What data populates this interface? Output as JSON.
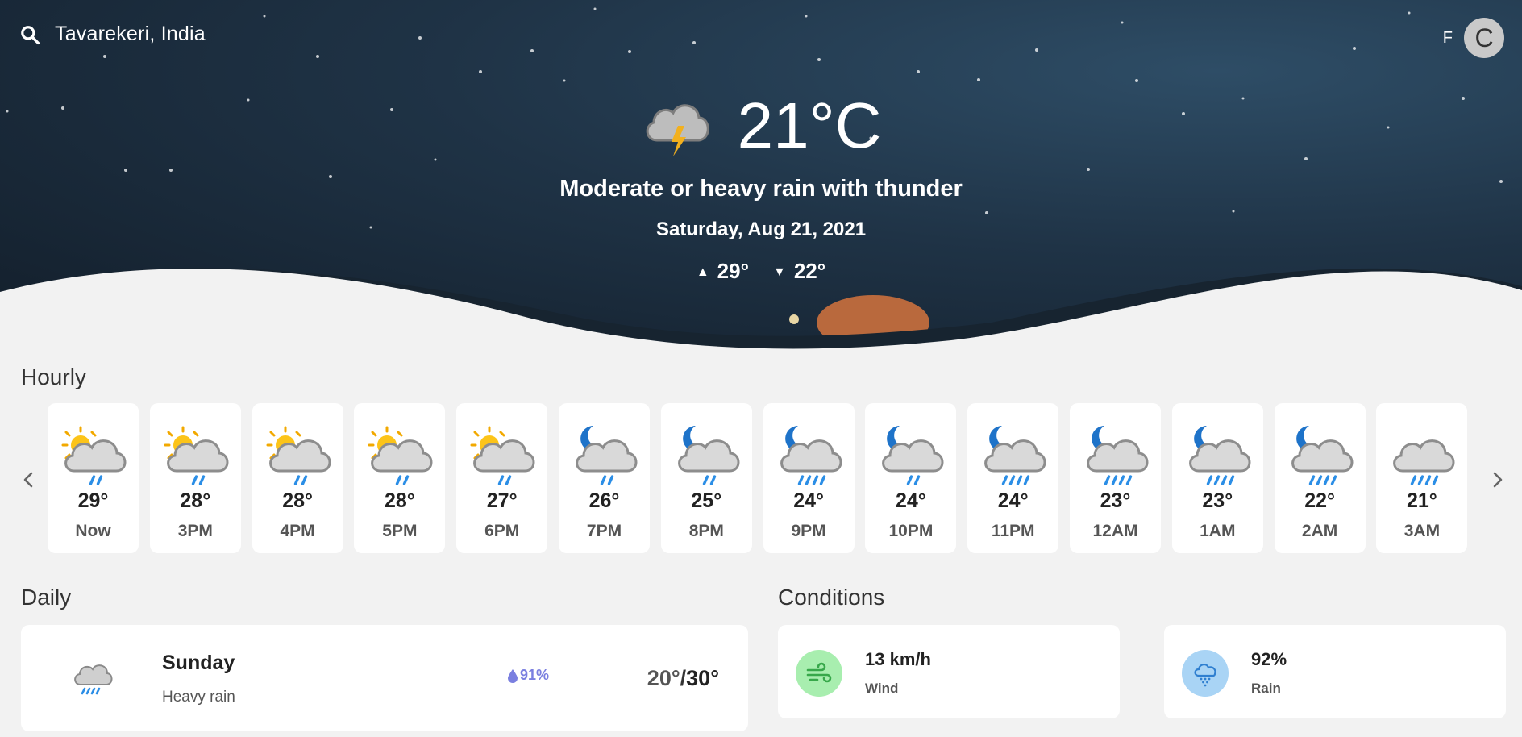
{
  "search": {
    "location": "Tavarekeri, India"
  },
  "units": {
    "fahrenheit": "F",
    "celsius": "C"
  },
  "current": {
    "temp": "21°C",
    "condition": "Moderate or heavy rain with thunder",
    "date": "Saturday, Aug 21, 2021",
    "high": "29°",
    "low": "22°",
    "icon": "thunder-cloud-icon"
  },
  "hourly": {
    "title": "Hourly",
    "items": [
      {
        "temp": "29°",
        "label": "Now",
        "icon": "sun-cloud-light-rain",
        "rain_lines": 2
      },
      {
        "temp": "28°",
        "label": "3PM",
        "icon": "sun-cloud-light-rain",
        "rain_lines": 2
      },
      {
        "temp": "28°",
        "label": "4PM",
        "icon": "sun-cloud-light-rain",
        "rain_lines": 2
      },
      {
        "temp": "28°",
        "label": "5PM",
        "icon": "sun-cloud-light-rain",
        "rain_lines": 2
      },
      {
        "temp": "27°",
        "label": "6PM",
        "icon": "sun-cloud-light-rain",
        "rain_lines": 2
      },
      {
        "temp": "26°",
        "label": "7PM",
        "icon": "moon-cloud-light-rain",
        "rain_lines": 2
      },
      {
        "temp": "25°",
        "label": "8PM",
        "icon": "moon-cloud-light-rain",
        "rain_lines": 2
      },
      {
        "temp": "24°",
        "label": "9PM",
        "icon": "moon-cloud-heavy-rain",
        "rain_lines": 4
      },
      {
        "temp": "24°",
        "label": "10PM",
        "icon": "moon-cloud-light-rain",
        "rain_lines": 2
      },
      {
        "temp": "24°",
        "label": "11PM",
        "icon": "moon-cloud-heavy-rain",
        "rain_lines": 4
      },
      {
        "temp": "23°",
        "label": "12AM",
        "icon": "moon-cloud-heavy-rain",
        "rain_lines": 4
      },
      {
        "temp": "23°",
        "label": "1AM",
        "icon": "moon-cloud-heavy-rain",
        "rain_lines": 4
      },
      {
        "temp": "22°",
        "label": "2AM",
        "icon": "moon-cloud-heavy-rain",
        "rain_lines": 4
      },
      {
        "temp": "21°",
        "label": "3AM",
        "icon": "cloud-heavy-rain",
        "rain_lines": 4
      }
    ]
  },
  "daily": {
    "title": "Daily",
    "items": [
      {
        "day": "Sunday",
        "description": "Heavy rain",
        "precip": "91%",
        "low": "20°",
        "high": "30°",
        "icon": "cloud-heavy-rain"
      }
    ]
  },
  "conditions": {
    "title": "Conditions",
    "wind": {
      "value": "13 km/h",
      "label": "Wind",
      "icon": "wind-icon",
      "color": "#a8eeaf"
    },
    "rain": {
      "value": "92%",
      "label": "Rain",
      "icon": "rain-cloud-icon",
      "color": "#a9d4f5"
    }
  }
}
